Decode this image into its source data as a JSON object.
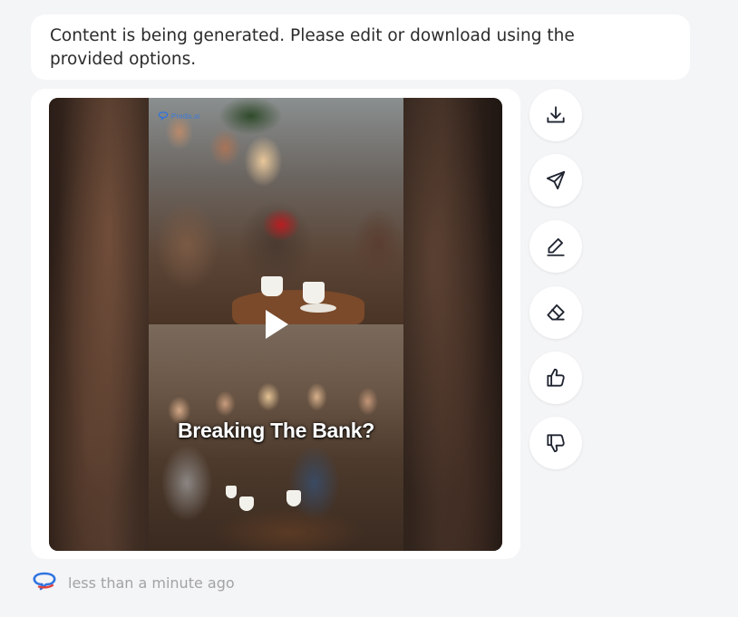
{
  "message": {
    "text": "Content is being generated. Please edit or download using the provided options."
  },
  "video": {
    "brand_logo_text": "Predis.ai",
    "caption": "Breaking The Bank?"
  },
  "actions": [
    {
      "name": "download-button",
      "icon": "download-icon"
    },
    {
      "name": "send-button",
      "icon": "paper-plane-icon"
    },
    {
      "name": "edit-button",
      "icon": "pencil-icon"
    },
    {
      "name": "erase-button",
      "icon": "eraser-icon"
    },
    {
      "name": "thumbs-up-button",
      "icon": "thumbs-up-icon"
    },
    {
      "name": "thumbs-down-button",
      "icon": "thumbs-down-icon"
    }
  ],
  "meta": {
    "timestamp": "less than a minute ago",
    "accent_blue": "#2f74e0",
    "accent_red": "#e0413d"
  }
}
